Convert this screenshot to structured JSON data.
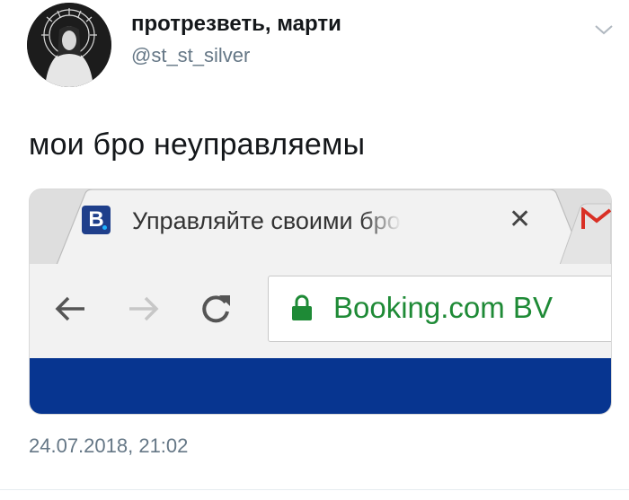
{
  "author": {
    "display_name": "протрезветь, марти",
    "handle": "@st_st_silver"
  },
  "tweet": {
    "text": "мои бро неуправляемы",
    "timestamp": "24.07.2018, 21:02"
  },
  "icons": {
    "menu": "chevron-down-icon",
    "favicon": "booking-favicon-icon",
    "close": "close-icon",
    "gmail": "gmail-icon",
    "back": "back-arrow-icon",
    "forward": "forward-arrow-icon",
    "reload": "reload-icon",
    "lock": "lock-icon"
  },
  "browser": {
    "tab": {
      "favicon_letter": "B",
      "title": "Управляйте своими бро",
      "close_symbol": "✕"
    },
    "url_text": "Booking.com BV"
  },
  "colors": {
    "page_bar": "#073590",
    "secure_green": "#1e8a36",
    "favicon_bg": "#1f3f8b"
  }
}
